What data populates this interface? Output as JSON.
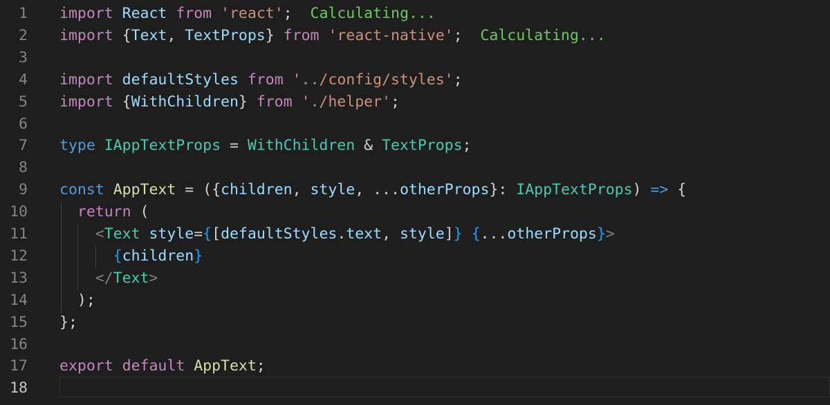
{
  "editor": {
    "lines": [
      {
        "num": "1",
        "tokens": [
          {
            "t": "import",
            "c": "t-kw"
          },
          {
            "t": " ",
            "c": "t-pun"
          },
          {
            "t": "React",
            "c": "t-var"
          },
          {
            "t": " ",
            "c": "t-pun"
          },
          {
            "t": "from",
            "c": "t-kw"
          },
          {
            "t": " ",
            "c": "t-pun"
          },
          {
            "t": "'react'",
            "c": "t-str"
          },
          {
            "t": ";",
            "c": "t-pun"
          },
          {
            "t": "  ",
            "c": "t-pun"
          },
          {
            "t": "Calculating...",
            "c": "t-hint"
          }
        ]
      },
      {
        "num": "2",
        "tokens": [
          {
            "t": "import",
            "c": "t-kw"
          },
          {
            "t": " {",
            "c": "t-pun"
          },
          {
            "t": "Text",
            "c": "t-var"
          },
          {
            "t": ", ",
            "c": "t-pun"
          },
          {
            "t": "TextProps",
            "c": "t-var"
          },
          {
            "t": "} ",
            "c": "t-pun"
          },
          {
            "t": "from",
            "c": "t-kw"
          },
          {
            "t": " ",
            "c": "t-pun"
          },
          {
            "t": "'react-native'",
            "c": "t-str"
          },
          {
            "t": ";",
            "c": "t-pun"
          },
          {
            "t": "  ",
            "c": "t-pun"
          },
          {
            "t": "Calculating...",
            "c": "t-hint"
          }
        ]
      },
      {
        "num": "3",
        "tokens": []
      },
      {
        "num": "4",
        "tokens": [
          {
            "t": "import",
            "c": "t-kw"
          },
          {
            "t": " ",
            "c": "t-pun"
          },
          {
            "t": "defaultStyles",
            "c": "t-var"
          },
          {
            "t": " ",
            "c": "t-pun"
          },
          {
            "t": "from",
            "c": "t-kw"
          },
          {
            "t": " ",
            "c": "t-pun"
          },
          {
            "t": "'../config/styles'",
            "c": "t-str"
          },
          {
            "t": ";",
            "c": "t-pun"
          }
        ]
      },
      {
        "num": "5",
        "tokens": [
          {
            "t": "import",
            "c": "t-kw"
          },
          {
            "t": " {",
            "c": "t-pun"
          },
          {
            "t": "WithChildren",
            "c": "t-var"
          },
          {
            "t": "} ",
            "c": "t-pun"
          },
          {
            "t": "from",
            "c": "t-kw"
          },
          {
            "t": " ",
            "c": "t-pun"
          },
          {
            "t": "'./helper'",
            "c": "t-str"
          },
          {
            "t": ";",
            "c": "t-pun"
          }
        ]
      },
      {
        "num": "6",
        "tokens": []
      },
      {
        "num": "7",
        "tokens": [
          {
            "t": "type",
            "c": "t-type"
          },
          {
            "t": " ",
            "c": "t-pun"
          },
          {
            "t": "IAppTextProps",
            "c": "t-cls"
          },
          {
            "t": " = ",
            "c": "t-pun"
          },
          {
            "t": "WithChildren",
            "c": "t-cls"
          },
          {
            "t": " & ",
            "c": "t-pun"
          },
          {
            "t": "TextProps",
            "c": "t-cls"
          },
          {
            "t": ";",
            "c": "t-pun"
          }
        ]
      },
      {
        "num": "8",
        "tokens": []
      },
      {
        "num": "9",
        "tokens": [
          {
            "t": "const",
            "c": "t-type"
          },
          {
            "t": " ",
            "c": "t-pun"
          },
          {
            "t": "AppText",
            "c": "t-fn"
          },
          {
            "t": " = ({",
            "c": "t-pun"
          },
          {
            "t": "children",
            "c": "t-var"
          },
          {
            "t": ", ",
            "c": "t-pun"
          },
          {
            "t": "style",
            "c": "t-var"
          },
          {
            "t": ", ...",
            "c": "t-pun"
          },
          {
            "t": "otherProps",
            "c": "t-var"
          },
          {
            "t": "}: ",
            "c": "t-pun"
          },
          {
            "t": "IAppTextProps",
            "c": "t-cls"
          },
          {
            "t": ") ",
            "c": "t-pun"
          },
          {
            "t": "=>",
            "c": "t-type"
          },
          {
            "t": " {",
            "c": "t-pun"
          }
        ]
      },
      {
        "num": "10",
        "tokens": [
          {
            "t": "  ",
            "c": "t-pun"
          },
          {
            "t": "return",
            "c": "t-kw"
          },
          {
            "t": " (",
            "c": "t-pun"
          }
        ]
      },
      {
        "num": "11",
        "tokens": [
          {
            "t": "    ",
            "c": "t-pun"
          },
          {
            "t": "<",
            "c": "t-tag"
          },
          {
            "t": "Text",
            "c": "t-cls"
          },
          {
            "t": " ",
            "c": "t-pun"
          },
          {
            "t": "style",
            "c": "t-attr"
          },
          {
            "t": "=",
            "c": "t-pun"
          },
          {
            "t": "{",
            "c": "t-brace"
          },
          {
            "t": "[",
            "c": "t-pun"
          },
          {
            "t": "defaultStyles",
            "c": "t-var"
          },
          {
            "t": ".",
            "c": "t-pun"
          },
          {
            "t": "text",
            "c": "t-var"
          },
          {
            "t": ", ",
            "c": "t-pun"
          },
          {
            "t": "style",
            "c": "t-var"
          },
          {
            "t": "]",
            "c": "t-pun"
          },
          {
            "t": "}",
            "c": "t-brace"
          },
          {
            "t": " ",
            "c": "t-pun"
          },
          {
            "t": "{",
            "c": "t-brace"
          },
          {
            "t": "...",
            "c": "t-pun"
          },
          {
            "t": "otherProps",
            "c": "t-var"
          },
          {
            "t": "}",
            "c": "t-brace"
          },
          {
            "t": ">",
            "c": "t-tag"
          }
        ]
      },
      {
        "num": "12",
        "tokens": [
          {
            "t": "      ",
            "c": "t-pun"
          },
          {
            "t": "{",
            "c": "t-brace"
          },
          {
            "t": "children",
            "c": "t-var"
          },
          {
            "t": "}",
            "c": "t-brace"
          }
        ]
      },
      {
        "num": "13",
        "tokens": [
          {
            "t": "    ",
            "c": "t-pun"
          },
          {
            "t": "</",
            "c": "t-tag"
          },
          {
            "t": "Text",
            "c": "t-cls"
          },
          {
            "t": ">",
            "c": "t-tag"
          }
        ]
      },
      {
        "num": "14",
        "tokens": [
          {
            "t": "  ",
            "c": "t-pun"
          },
          {
            "t": ");",
            "c": "t-pun"
          }
        ]
      },
      {
        "num": "15",
        "tokens": [
          {
            "t": "};",
            "c": "t-pun"
          }
        ]
      },
      {
        "num": "16",
        "tokens": []
      },
      {
        "num": "17",
        "tokens": [
          {
            "t": "export",
            "c": "t-kw"
          },
          {
            "t": " ",
            "c": "t-pun"
          },
          {
            "t": "default",
            "c": "t-kw"
          },
          {
            "t": " ",
            "c": "t-pun"
          },
          {
            "t": "AppText",
            "c": "t-fn"
          },
          {
            "t": ";",
            "c": "t-pun"
          }
        ]
      },
      {
        "num": "18",
        "tokens": [],
        "active": true
      }
    ]
  },
  "colors": {
    "background": "#1e1e1e",
    "keyword": "#c586c0",
    "storage": "#569cd6",
    "variable": "#9cdcfe",
    "type": "#4ec9b0",
    "function": "#dcdcaa",
    "string": "#ce9178",
    "inlay_hint": "#6ccb5f",
    "line_number": "#858585"
  }
}
